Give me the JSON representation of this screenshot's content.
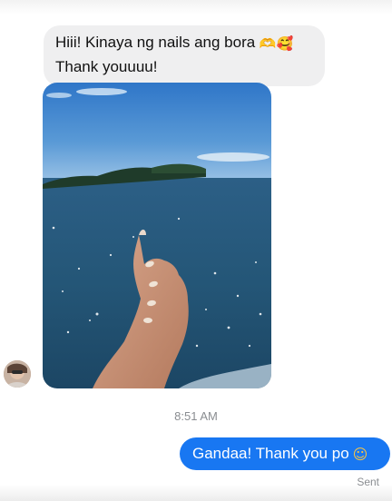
{
  "thread": {
    "incoming_message": {
      "line1": "Hiii! Kinaya ng nails ang bora",
      "line1_emojis": [
        "heart-hands-emoji",
        "smiling-face-with-hearts-emoji"
      ],
      "line1_emoji_glyphs": [
        "🫶",
        "🥰"
      ],
      "line2": "Thank youuuu!"
    },
    "incoming_photo": {
      "subject": "hand-with-manicured-nails-over-sea-photo"
    },
    "timestamp": "8:51 AM",
    "outgoing_message": {
      "text": "Gandaa! Thank you po",
      "emoji": "smiling-face-emoji",
      "emoji_glyph": "☺"
    },
    "status": "Sent"
  },
  "colors": {
    "incoming_bubble": "#efeff0",
    "outgoing_bubble": "#1877f2",
    "meta_text": "#8a8d91"
  }
}
